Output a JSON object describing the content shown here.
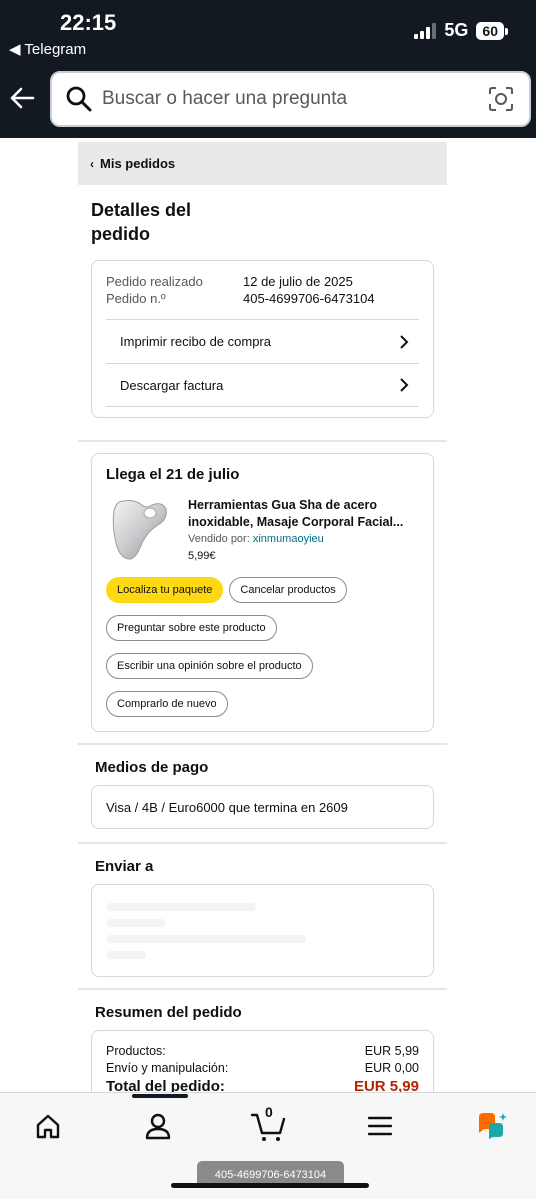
{
  "status_bar": {
    "time": "22:15",
    "back_app": "◀ Telegram",
    "network": "5G",
    "battery": "60"
  },
  "search": {
    "placeholder": "Buscar o hacer una pregunta"
  },
  "breadcrumb": {
    "label": "Mis pedidos"
  },
  "page": {
    "title": "Detalles del pedido"
  },
  "order": {
    "placed_label": "Pedido realizado",
    "placed_value": "12 de julio de 2025",
    "number_label": "Pedido n.º",
    "number_value": "405-4699706-6473104",
    "links": [
      "Imprimir recibo de compra",
      "Descargar factura"
    ]
  },
  "shipment": {
    "arrival": "Llega el 21 de julio",
    "product_name": "Herramientas Gua Sha de acero inoxidable, Masaje Corporal Facial...",
    "sold_by_label": "Vendido por:",
    "seller": "xinmumaoyieu",
    "price": "5,99€",
    "buttons": {
      "track": "Localiza tu paquete",
      "cancel": "Cancelar productos",
      "ask": "Preguntar sobre este producto",
      "review": "Escribir una opinión sobre el producto",
      "buy_again": "Comprarlo de nuevo"
    }
  },
  "payment": {
    "title": "Medios de pago",
    "method": "Visa / 4B / Euro6000  que termina en 2609"
  },
  "shipping": {
    "title": "Enviar a"
  },
  "summary": {
    "title": "Resumen del pedido",
    "products_label": "Productos:",
    "products_value": "EUR 5,99",
    "shipping_label": "Envío y manipulación:",
    "shipping_value": "EUR 0,00",
    "total_label": "Total del pedido:",
    "total_value": "EUR 5,99"
  },
  "bottom_nav": {
    "cart_count": "0",
    "toast": "405-4699706-6473104"
  },
  "colors": {
    "header_bg": "#131921",
    "primary_button": "#ffd814",
    "link": "#007185",
    "total_price": "#b12704"
  }
}
